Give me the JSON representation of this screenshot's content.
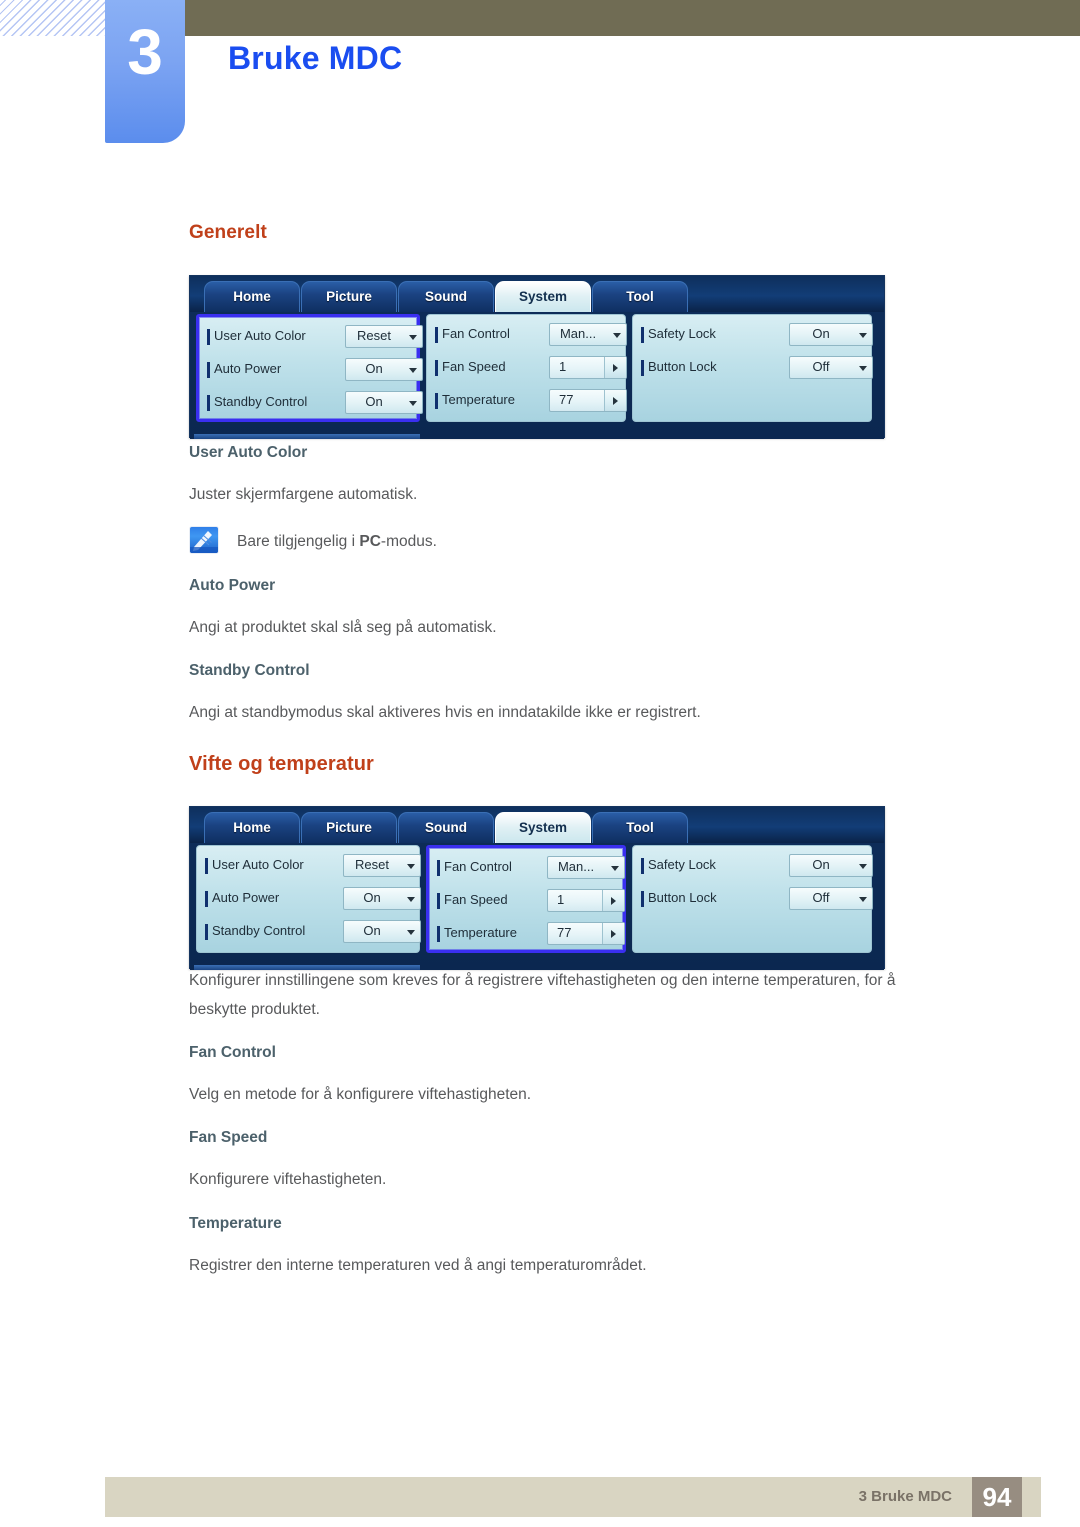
{
  "header": {
    "chapter_number": "3",
    "chapter_title": "Bruke MDC"
  },
  "sections": [
    {
      "heading": "Generelt",
      "subsections": [
        {
          "title": "User Auto Color",
          "body": "Juster skjermfargene automatisk.",
          "note": {
            "prefix": "Bare tilgjengelig i ",
            "bold": "PC",
            "suffix": "-modus.",
            "icon": "note-pencil-icon"
          }
        },
        {
          "title": "Auto Power",
          "body": "Angi at produktet skal slå seg på automatisk."
        },
        {
          "title": "Standby Control",
          "body": "Angi at standbymodus skal aktiveres hvis en inndatakilde ikke er registrert."
        }
      ]
    },
    {
      "heading": "Vifte og temperatur",
      "intro_line1": "Konfigurer innstillingene som kreves for å registrere viftehastigheten og den interne temperaturen, for å",
      "intro_line2": "beskytte produktet.",
      "subsections": [
        {
          "title": "Fan Control",
          "body": "Velg en metode for å konfigurere viftehastigheten."
        },
        {
          "title": "Fan Speed",
          "body": "Konfigurere viftehastigheten."
        },
        {
          "title": "Temperature",
          "body": "Registrer den interne temperaturen ved å angi temperaturområdet."
        }
      ]
    }
  ],
  "mdc": {
    "tabs": [
      {
        "label": "Home",
        "active": false
      },
      {
        "label": "Picture",
        "active": false
      },
      {
        "label": "Sound",
        "active": false
      },
      {
        "label": "System",
        "active": true
      },
      {
        "label": "Tool",
        "active": false
      }
    ],
    "groups": {
      "general": {
        "rows": [
          {
            "label": "User Auto Color",
            "value": "Reset",
            "control": "dropdown"
          },
          {
            "label": "Auto Power",
            "value": "On",
            "control": "dropdown"
          },
          {
            "label": "Standby Control",
            "value": "On",
            "control": "dropdown"
          }
        ]
      },
      "fan": {
        "rows": [
          {
            "label": "Fan Control",
            "value": "Man...",
            "control": "dropdown"
          },
          {
            "label": "Fan Speed",
            "value": "1",
            "control": "spinner"
          },
          {
            "label": "Temperature",
            "value": "77",
            "control": "spinner"
          }
        ]
      },
      "lock": {
        "rows": [
          {
            "label": "Safety Lock",
            "value": "On",
            "control": "dropdown"
          },
          {
            "label": "Button Lock",
            "value": "Off",
            "control": "dropdown"
          }
        ]
      }
    },
    "screenshot_1_highlight": "general",
    "screenshot_2_highlight": "fan"
  },
  "footer": {
    "label": "3 Bruke MDC",
    "page": "94"
  },
  "colors": {
    "heading_orange": "#c0401a",
    "subheading_slate": "#4c616b",
    "body_gray": "#58595b",
    "chapter_blue": "#1a4df0",
    "header_bar": "#706c54",
    "footer_bar": "#d9d5c2",
    "footer_page_box": "#978d81",
    "mdc_selection": "#3a2ff0"
  }
}
